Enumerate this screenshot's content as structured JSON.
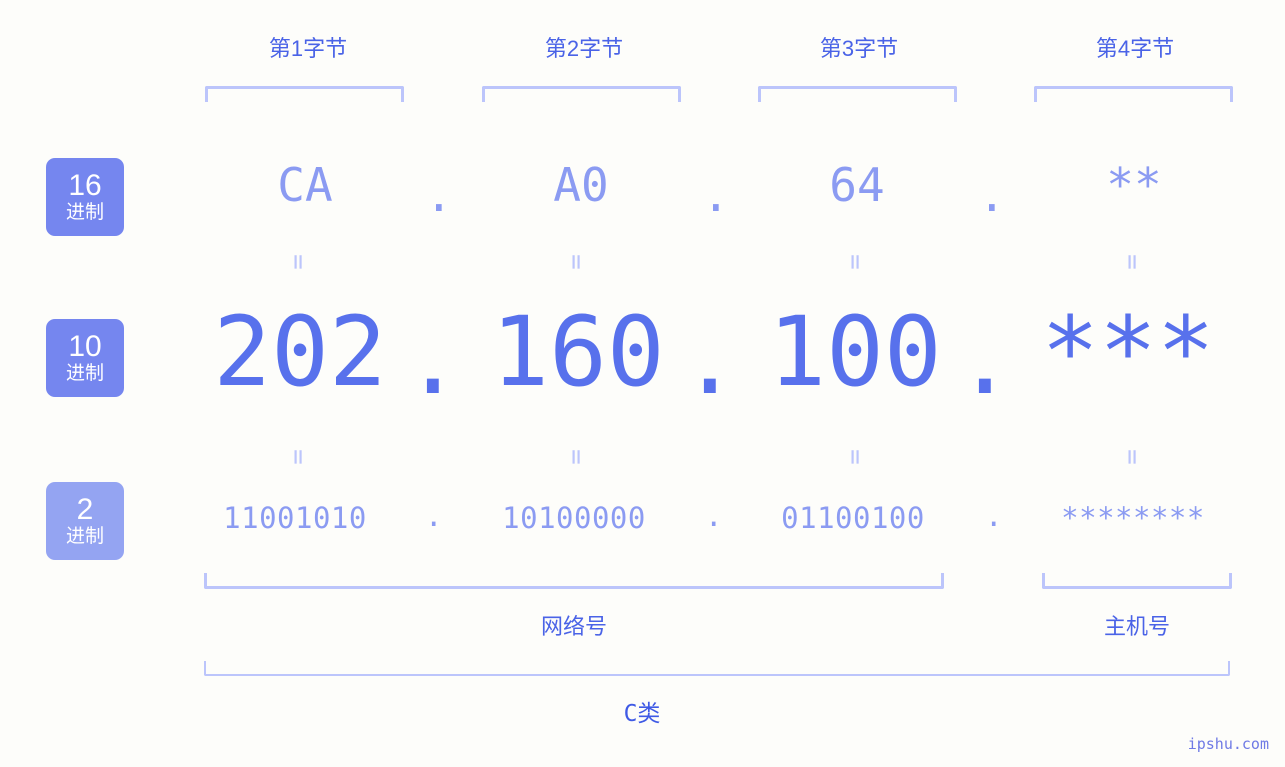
{
  "page": {
    "background_color": "#fdfdfa",
    "accent_color": "#5871ec",
    "accent_light_color": "#8b9bf2",
    "bracket_color": "#bcc5fb",
    "badge_color": "#7586ef",
    "badge_light_color": "#94a4f2"
  },
  "byte_headers": [
    {
      "label": "第1字节"
    },
    {
      "label": "第2字节"
    },
    {
      "label": "第3字节"
    },
    {
      "label": "第4字节"
    }
  ],
  "base_badges": [
    {
      "number": "16",
      "system": "进制",
      "name": "hexadecimal"
    },
    {
      "number": "10",
      "system": "进制",
      "name": "decimal"
    },
    {
      "number": "2",
      "system": "进制",
      "name": "binary"
    }
  ],
  "rows": {
    "hex": {
      "values": [
        "CA",
        "A0",
        "64",
        "**"
      ],
      "separator": "."
    },
    "decimal": {
      "values": [
        "202",
        "160",
        "100",
        "***"
      ],
      "separator": "."
    },
    "binary": {
      "values": [
        "11001010",
        "10100000",
        "01100100",
        "********"
      ],
      "separator": "."
    }
  },
  "equals_symbol": "=",
  "sections": {
    "network": {
      "label": "网络号"
    },
    "host": {
      "label": "主机号"
    },
    "class": {
      "label": "C类"
    }
  },
  "watermark": {
    "text": "ipshu.com"
  }
}
